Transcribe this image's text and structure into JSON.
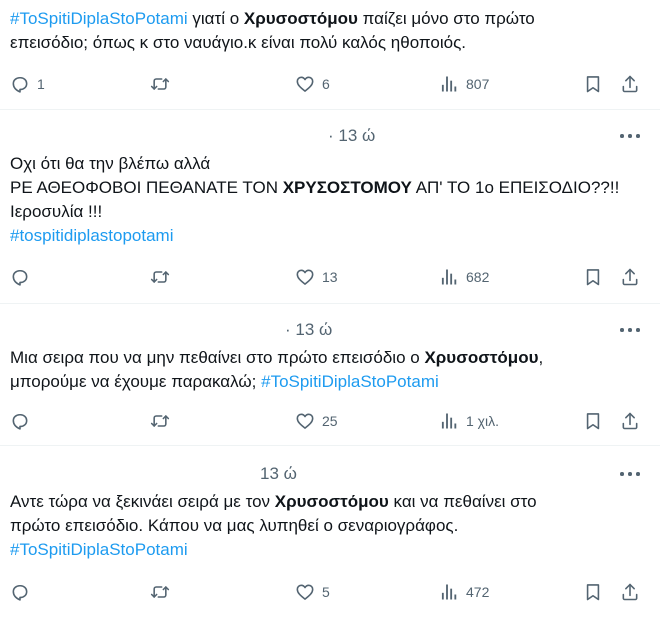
{
  "tweets": [
    {
      "time": "",
      "lines": [
        [
          {
            "t": "#ToSpitiDiplaStoPotami",
            "k": "tag"
          },
          {
            "t": " γιατί ο ",
            "k": "plain"
          },
          {
            "t": "Χρυσοστόμου",
            "k": "bold"
          },
          {
            "t": " παίζει μόνο στο πρώτο",
            "k": "plain"
          }
        ],
        [
          {
            "t": "επεισόδιο; όπως κ στο ναυάγιο.κ είναι πολύ καλός ηθοποιός.",
            "k": "plain"
          }
        ]
      ],
      "replies": "1",
      "retweets": "",
      "likes": "6",
      "views": "807"
    },
    {
      "time": "· 13 ώ",
      "lines": [
        [
          {
            "t": "Οχι ότι θα την βλέπω αλλά",
            "k": "plain"
          }
        ],
        [
          {
            "t": "ΡΕ ΑΘΕΟΦΟΒΟΙ ΠΕΘΑΝΑΤΕ ΤΟΝ ",
            "k": "plain"
          },
          {
            "t": "ΧΡΥΣΟΣΤΟΜΟΥ",
            "k": "bold"
          },
          {
            "t": " ΑΠ' ΤΟ 1ο ΕΠΕΙΣΟΔΙΟ??!!",
            "k": "plain"
          }
        ],
        [
          {
            "t": "Ιεροσυλία !!!",
            "k": "plain"
          }
        ],
        [
          {
            "t": "#tospitidiplastopotami",
            "k": "tag"
          }
        ]
      ],
      "replies": "",
      "retweets": "",
      "likes": "13",
      "views": "682"
    },
    {
      "time": "· 13 ώ",
      "lines": [
        [
          {
            "t": "Μια σειρα που να μην πεθαίνει στο πρώτο επεισόδιο ο ",
            "k": "plain"
          },
          {
            "t": "Χρυσοστόμου",
            "k": "bold"
          },
          {
            "t": ",",
            "k": "plain"
          }
        ],
        [
          {
            "t": "μπορούμε να έχουμε παρακαλώ; ",
            "k": "plain"
          },
          {
            "t": "#ToSpitiDiplaStoPotami",
            "k": "tag"
          }
        ]
      ],
      "replies": "",
      "retweets": "",
      "likes": "25",
      "views": "1 χιλ."
    },
    {
      "time": "13 ώ",
      "lines": [
        [
          {
            "t": "Αντε τώρα να ξεκινάει σειρά με τον ",
            "k": "plain"
          },
          {
            "t": "Χρυσοστόμου",
            "k": "bold"
          },
          {
            "t": " και να πεθαίνει στο",
            "k": "plain"
          }
        ],
        [
          {
            "t": "πρώτο επεισόδιο. Κάπου να μας λυπηθεί ο σεναριογράφος.",
            "k": "plain"
          }
        ],
        [
          {
            "t": "#ToSpitiDiplaStoPotami",
            "k": "tag"
          }
        ]
      ],
      "replies": "",
      "retweets": "",
      "likes": "5",
      "views": "472"
    }
  ],
  "icons": {
    "reply": "reply-icon",
    "retweet": "retweet-icon",
    "like": "heart-icon",
    "views": "views-icon",
    "bookmark": "bookmark-icon",
    "share": "share-icon",
    "more": "more-icon"
  },
  "colors": {
    "hashtag": "#1d9bf0",
    "muted": "#536471",
    "text": "#0f1419",
    "divider": "#eff3f4"
  }
}
